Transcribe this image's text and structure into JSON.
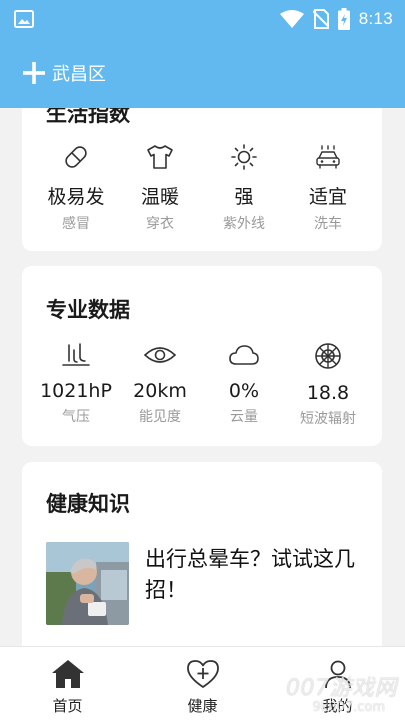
{
  "status": {
    "time": "8:13"
  },
  "header": {
    "city": "武昌区"
  },
  "life_index": {
    "title": "生活指数",
    "items": [
      {
        "icon": "pill-icon",
        "value": "极易发",
        "label": "感冒"
      },
      {
        "icon": "shirt-icon",
        "value": "温暖",
        "label": "穿衣"
      },
      {
        "icon": "sun-icon",
        "value": "强",
        "label": "紫外线"
      },
      {
        "icon": "car-wash-icon",
        "value": "适宜",
        "label": "洗车"
      }
    ]
  },
  "pro_data": {
    "title": "专业数据",
    "items": [
      {
        "icon": "pressure-icon",
        "value": "1021hP",
        "label": "气压"
      },
      {
        "icon": "eye-icon",
        "value": "20km",
        "label": "能见度"
      },
      {
        "icon": "cloud-icon",
        "value": "0%",
        "label": "云量"
      },
      {
        "icon": "radiation-icon",
        "value": "18.8",
        "label": "短波辐射"
      }
    ]
  },
  "health": {
    "title": "健康知识",
    "article_title": "出行总晕车？试试这几招！"
  },
  "nav": {
    "tabs": [
      {
        "icon": "home-icon",
        "label": "首页"
      },
      {
        "icon": "heart-plus-icon",
        "label": "健康"
      },
      {
        "icon": "person-icon",
        "label": "我的"
      }
    ]
  },
  "watermark": {
    "main": "007游戏网",
    "sub": "9k007.com"
  },
  "colors": {
    "accent": "#62b9f0",
    "background": "#f2f2f2"
  }
}
